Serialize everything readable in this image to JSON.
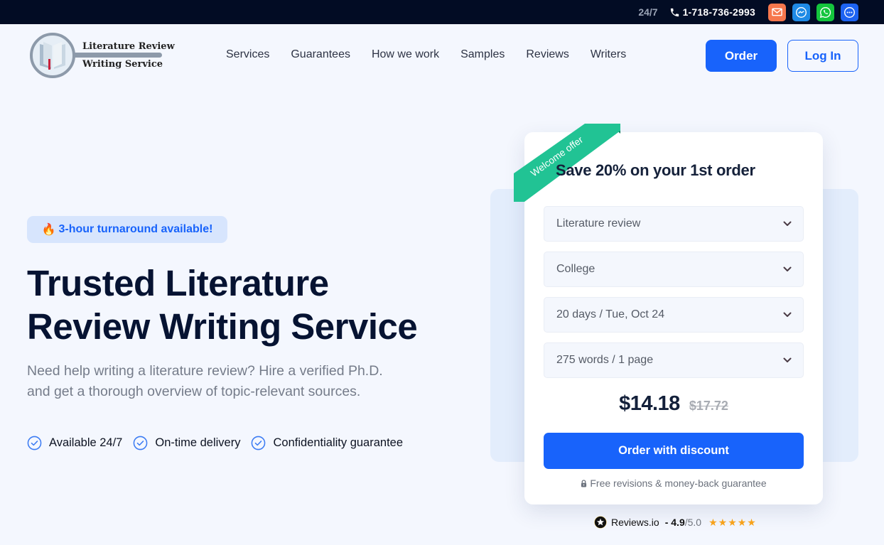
{
  "topbar": {
    "hours": "24/7",
    "phone": "1-718-736-2993",
    "channels": [
      {
        "name": "email",
        "icon": "mail-icon",
        "color": "#f6774d"
      },
      {
        "name": "messenger",
        "icon": "messenger-icon",
        "color": "#1f8ae6"
      },
      {
        "name": "whatsapp",
        "icon": "whatsapp-icon",
        "color": "#14c53d"
      },
      {
        "name": "chat",
        "icon": "chat-bubble-icon",
        "color": "#1d63f2"
      }
    ]
  },
  "header": {
    "logo": {
      "line1": "Literature Review",
      "line2": "Writing Service"
    },
    "nav": [
      "Services",
      "Guarantees",
      "How we work",
      "Samples",
      "Reviews",
      "Writers"
    ],
    "order_label": "Order",
    "login_label": "Log In"
  },
  "hero": {
    "badge_icon": "🔥",
    "badge": "3-hour turnaround available!",
    "title_line1": "Trusted Literature",
    "title_line2": "Review Writing Service",
    "subtitle_line1": "Need help writing a literature review? Hire a verified Ph.D.",
    "subtitle_line2": "and get a thorough overview of topic-relevant sources.",
    "features": [
      "Available 24/7",
      "On-time delivery",
      "Confidentiality guarantee"
    ]
  },
  "order_form": {
    "ribbon": "Welcome offer",
    "title": "Save 20% on your 1st order",
    "selects": [
      {
        "name": "paper-type",
        "value": "Literature review"
      },
      {
        "name": "academic-level",
        "value": "College"
      },
      {
        "name": "deadline",
        "value": "20 days / Tue, Oct 24"
      },
      {
        "name": "pages",
        "value": "275 words / 1 page"
      }
    ],
    "price": "$14.18",
    "old_price": "$17.72",
    "button": "Order with discount",
    "guarantee": "Free revisions & money-back guarantee"
  },
  "reviews": {
    "brand": "Reviews.io",
    "separator": "- ",
    "score": "4.9",
    "max": "/5.0",
    "stars": "★★★★★",
    "rating": 5
  },
  "colors": {
    "accent": "#1863fb",
    "ribbon": "#21c394",
    "ribbon_fold": "#0b6e50",
    "star": "#f7a21b",
    "topbar_bg": "#020c24"
  }
}
